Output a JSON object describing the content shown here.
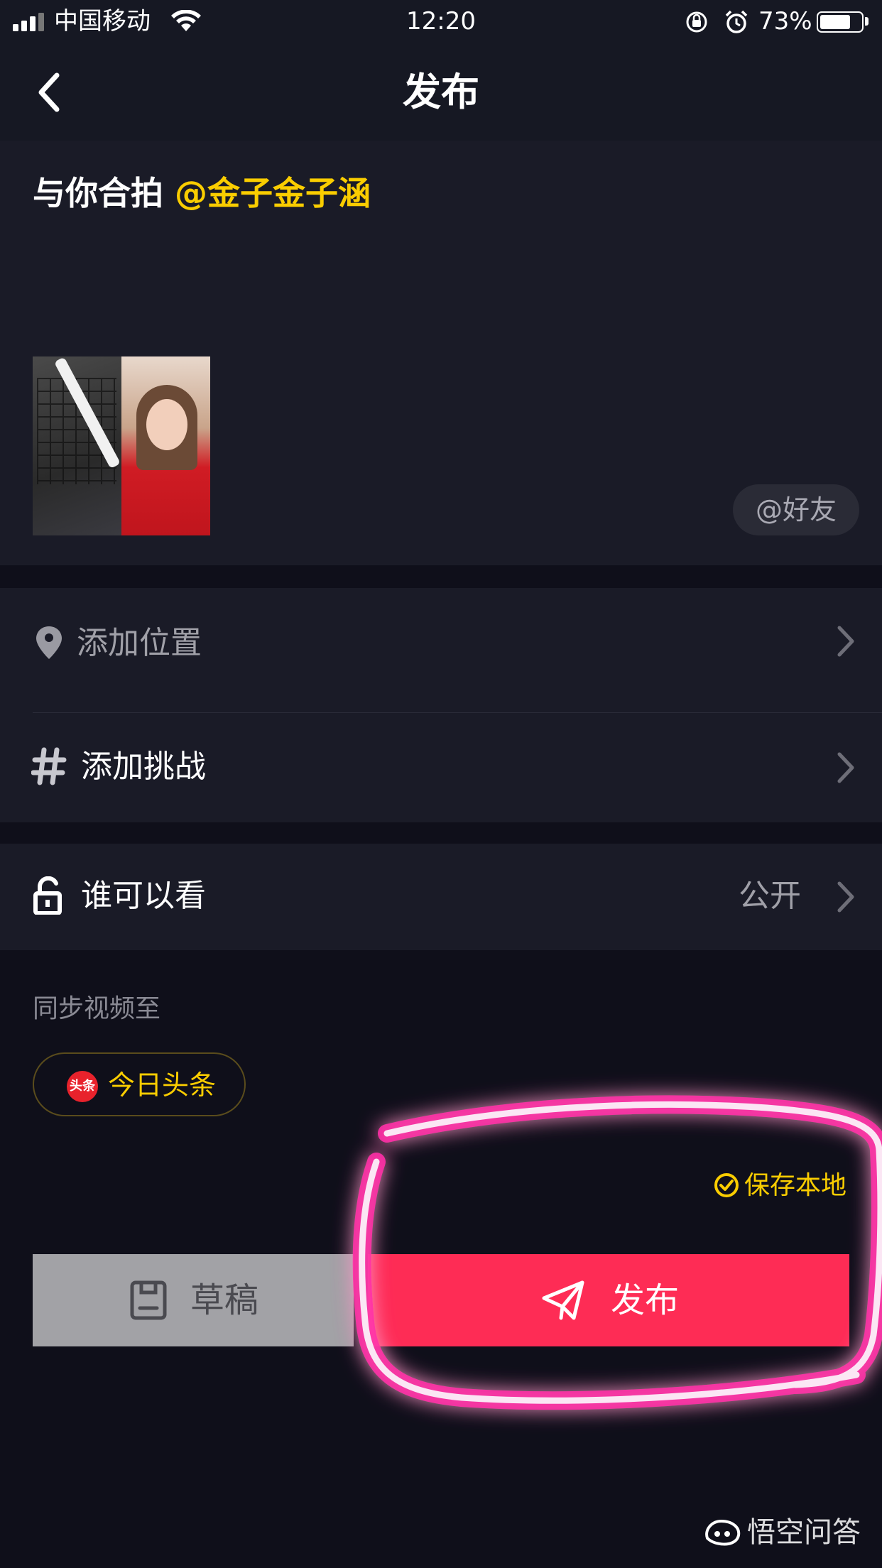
{
  "status_bar": {
    "carrier": "中国移动",
    "time": "12:20",
    "battery_percent": "73%",
    "battery_level": 0.73
  },
  "nav": {
    "title": "发布",
    "back_icon": "chevron-left-icon"
  },
  "caption": {
    "prefix": "与你合拍 ",
    "mention": "@金子金子涵",
    "mention_color": "#facd00"
  },
  "friend_button": {
    "label": "@好友"
  },
  "rows": {
    "location": {
      "label": "添加位置",
      "icon": "location-pin-icon"
    },
    "challenge": {
      "label": "添加挑战",
      "icon": "hashtag-icon"
    },
    "visibility": {
      "label": "谁可以看",
      "value": "公开",
      "icon": "unlock-icon"
    }
  },
  "sync": {
    "label": "同步视频至",
    "toutiao_logo_text": "头条",
    "toutiao_label": "今日头条"
  },
  "save_local": {
    "label": "保存本地",
    "checked": true
  },
  "buttons": {
    "draft": "草稿",
    "publish": "发布",
    "publish_color": "#fe2c55"
  },
  "watermark": {
    "text": "悟空问答"
  }
}
